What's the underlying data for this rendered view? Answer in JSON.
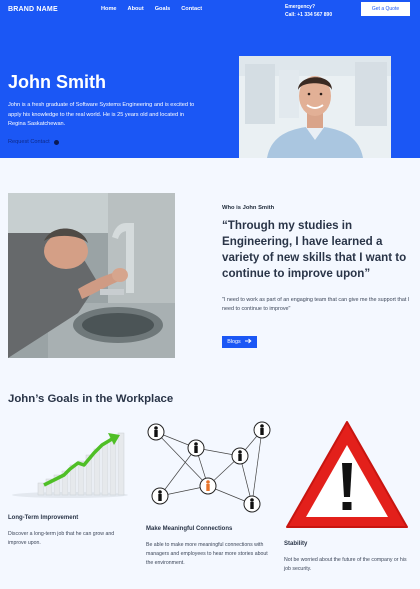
{
  "header": {
    "brand": "BRAND NAME",
    "nav": [
      "Home",
      "About",
      "Goals",
      "Contact"
    ],
    "emergency_label": "Emergency?",
    "emergency_phone": "Call: +1 334 567 890",
    "quote_button": "Get a Quote"
  },
  "hero": {
    "name": "John Smith",
    "bio": "John is a fresh graduate of Software Systems Engineering and is excited to apply his knowledge to the real world. He is 25 years old and located in Regina Saskatchewan.",
    "link_label": "Request Contact"
  },
  "about": {
    "label": "Who is John Smith",
    "quote": "“Through my studies in Engineering, I have learned a variety of new skills that I want to continue to improve upon”",
    "sub": "\"I need to work as part of an engaging team that can give me the support that I need to continue to improve\"",
    "button": "Blogs"
  },
  "goals": {
    "title": "John’s Goals in the Workplace",
    "items": [
      {
        "title": "Long-Term Improvement",
        "text": "Discover a long-term job that he can grow and improve upon."
      },
      {
        "title": "Make Meaningful Connections",
        "text": "Be able to make more meaningful connections with managers and employees to hear more stories about the environment."
      },
      {
        "title": "Stability",
        "text": "Not be worried about the future of the company or his job security."
      }
    ]
  },
  "colors": {
    "brand_blue": "#1b57f5",
    "white": "#ffffff",
    "warning_red": "#e3201b"
  }
}
